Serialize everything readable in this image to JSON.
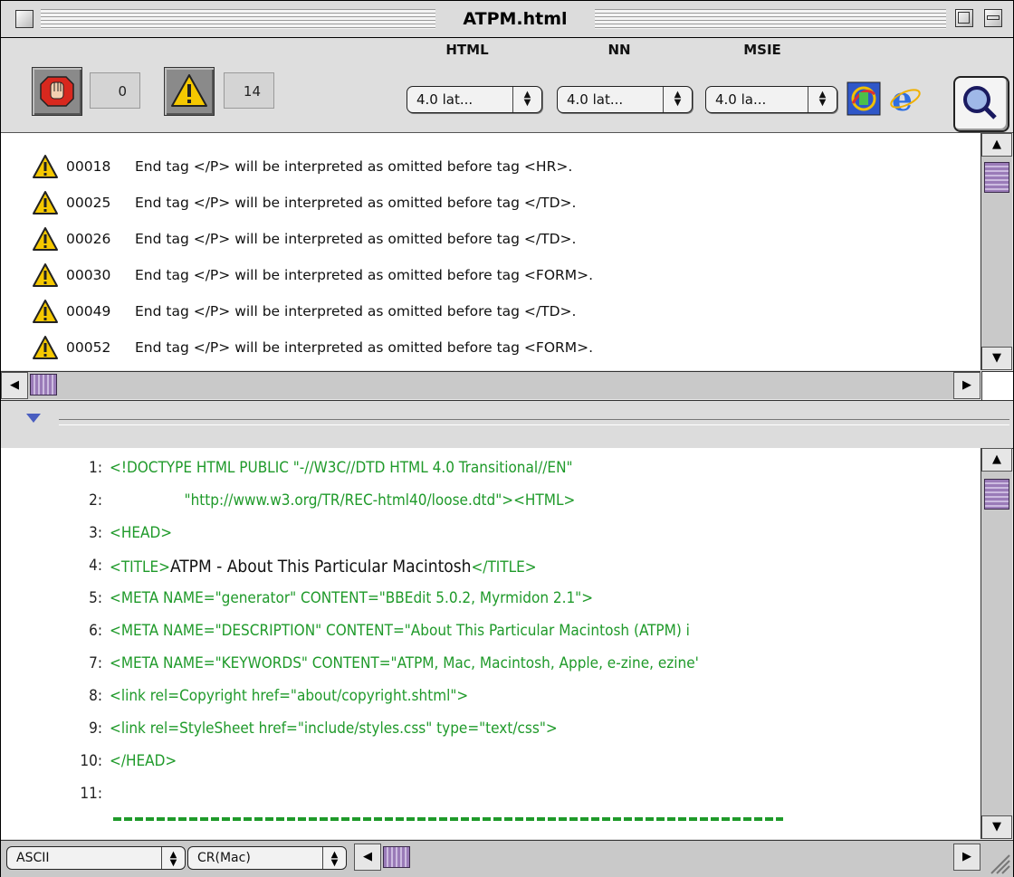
{
  "window": {
    "title": "ATPM.html"
  },
  "toolbar": {
    "errors_count": "0",
    "warnings_count": "14",
    "html_label": "HTML",
    "html_value": "4.0 lat...",
    "nn_label": "NN",
    "nn_value": "4.0 lat...",
    "msie_label": "MSIE",
    "msie_value": "4.0 la...",
    "icons": [
      "stop-hand-icon",
      "warning-icon",
      "netscape-icon",
      "internet-explorer-icon",
      "magnifier-icon"
    ]
  },
  "messages": [
    {
      "code": "00018",
      "text": "End tag </P> will be interpreted as omitted before tag <HR>."
    },
    {
      "code": "00025",
      "text": "End tag </P> will be interpreted as omitted before tag </TD>."
    },
    {
      "code": "00026",
      "text": "End tag </P> will be interpreted as omitted before tag </TD>."
    },
    {
      "code": "00030",
      "text": "End tag </P> will be interpreted as omitted before tag <FORM>."
    },
    {
      "code": "00049",
      "text": "End tag </P> will be interpreted as omitted before tag </TD>."
    },
    {
      "code": "00052",
      "text": "End tag </P> will be interpreted as omitted before tag <FORM>."
    }
  ],
  "source": {
    "lines": [
      {
        "num": "1:",
        "code": "<!DOCTYPE HTML PUBLIC \"-//W3C//DTD HTML 4.0 Transitional//EN\""
      },
      {
        "num": "2:",
        "code": "                 \"http://www.w3.org/TR/REC-html40/loose.dtd\"><HTML>"
      },
      {
        "num": "3:",
        "code": "<HEAD>"
      },
      {
        "num": "4:",
        "code_before": "<TITLE>",
        "plain": "ATPM - About This Particular Macintosh",
        "code_after": "</TITLE>"
      },
      {
        "num": "5:",
        "code": "<META NAME=\"generator\" CONTENT=\"BBEdit 5.0.2, Myrmidon 2.1\">"
      },
      {
        "num": "6:",
        "code": "<META NAME=\"DESCRIPTION\" CONTENT=\"About This Particular Macintosh (ATPM) i"
      },
      {
        "num": "7:",
        "code": "<META NAME=\"KEYWORDS\" CONTENT=\"ATPM, Mac, Macintosh, Apple, e-zine, ezine'"
      },
      {
        "num": "8:",
        "code": "<link rel=Copyright href=\"about/copyright.shtml\">"
      },
      {
        "num": "9:",
        "code": "<link rel=StyleSheet href=\"include/styles.css\" type=\"text/css\">"
      },
      {
        "num": "10:",
        "code": "</HEAD>"
      },
      {
        "num": "11:",
        "code": ""
      }
    ]
  },
  "status": {
    "encoding": "ASCII",
    "line_endings": "CR(Mac)"
  },
  "colors": {
    "code_green": "#1f9a2a",
    "scroll_thumb": "#9a7bb8",
    "warning_yellow": "#f5c800"
  }
}
